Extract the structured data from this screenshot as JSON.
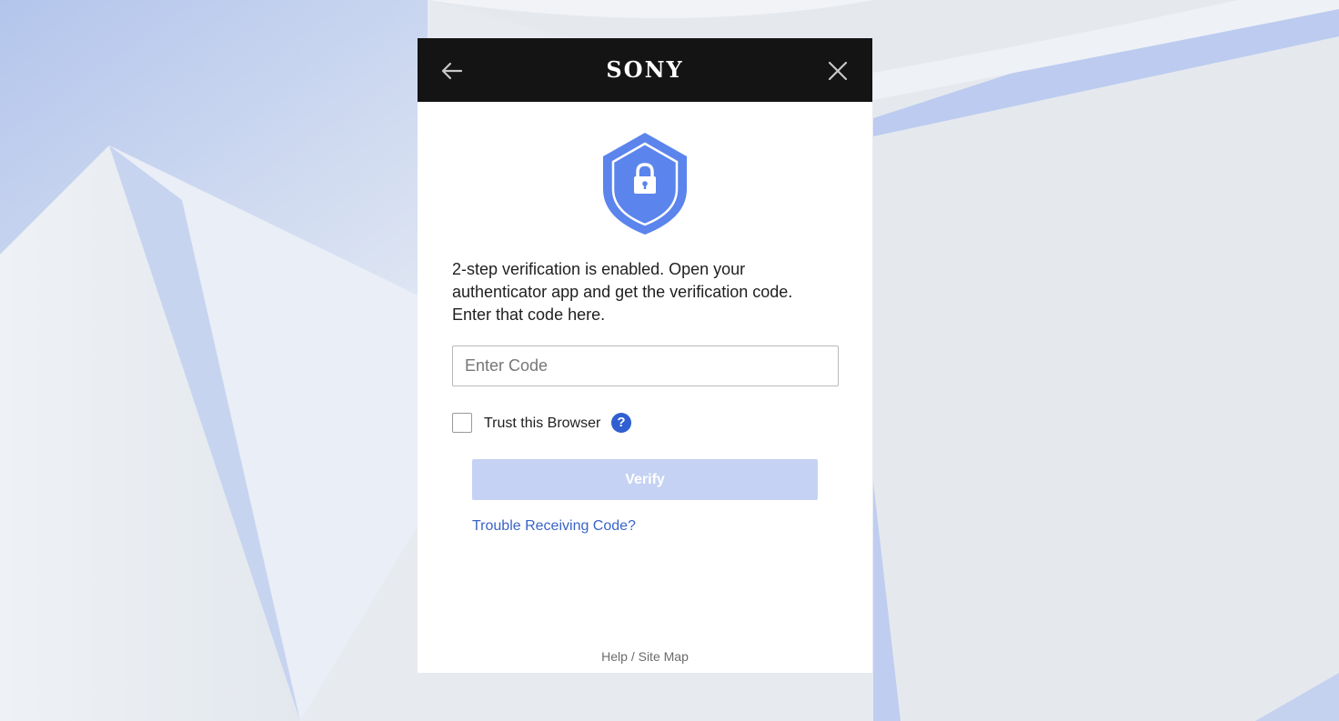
{
  "header": {
    "logo_text": "SONY",
    "back_icon": "arrow-left-icon",
    "close_icon": "close-icon"
  },
  "shield": {
    "icon": "shield-lock-icon",
    "color": "#5b84ec"
  },
  "message": "2-step verification is enabled. Open your authenticator app and get the verification code. Enter that code here.",
  "code_input": {
    "value": "",
    "placeholder": "Enter Code"
  },
  "trust_browser": {
    "label": "Trust this Browser",
    "checked": false,
    "help_icon": "question-circle-icon",
    "help_glyph": "?"
  },
  "verify_button": {
    "label": "Verify",
    "enabled": false
  },
  "trouble_link": "Trouble Receiving Code?",
  "footer": {
    "help": "Help",
    "separator": " / ",
    "site_map": "Site Map"
  },
  "colors": {
    "header_bg": "#141414",
    "accent": "#2f5fd0",
    "link": "#3a63c9",
    "verify_disabled": "#c5d2f3"
  }
}
